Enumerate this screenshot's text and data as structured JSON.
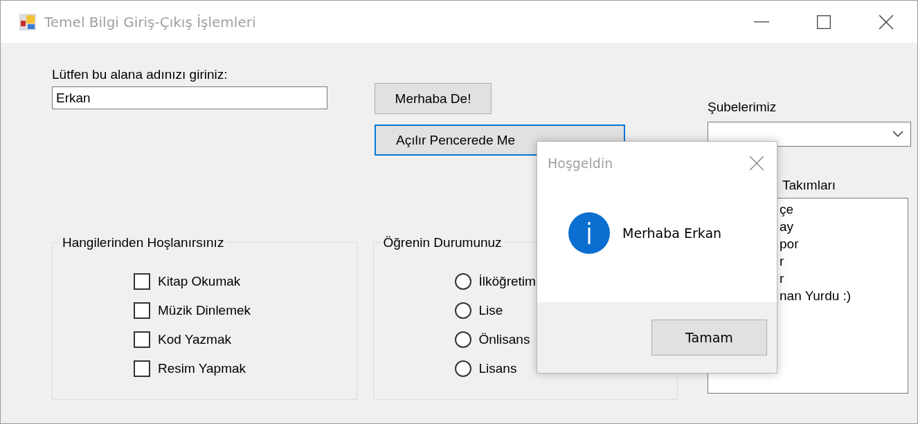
{
  "window": {
    "title": "Temel Bilgi Giriş-Çıkış İşlemleri"
  },
  "name_input": {
    "label": "Lütfen bu alana adınızı giriniz:",
    "value": "Erkan"
  },
  "buttons": [
    {
      "label": "Merhaba De!",
      "focused": false
    },
    {
      "label": "Açılır Pencerede Me",
      "focused": true
    }
  ],
  "hobbies": {
    "title": "Hangilerinden Hoşlanırsınız",
    "items": [
      {
        "label": "Kitap Okumak",
        "checked": false
      },
      {
        "label": "Müzik Dinlemek",
        "checked": false
      },
      {
        "label": "Kod Yazmak",
        "checked": false
      },
      {
        "label": "Resim Yapmak",
        "checked": false
      }
    ]
  },
  "education": {
    "title": "Öğrenin Durumunuz",
    "options": [
      {
        "label": "İlköğretim",
        "selected": false
      },
      {
        "label": "Lise",
        "selected": false
      },
      {
        "label": "Önlisans",
        "selected": false
      },
      {
        "label": "Lisans",
        "selected": false
      }
    ]
  },
  "branches": {
    "label": "Şubelerimiz"
  },
  "teams": {
    "label": "Takımları",
    "items": [
      {
        "text": "çe"
      },
      {
        "text": "ay"
      },
      {
        "text": "por"
      },
      {
        "text": "r"
      },
      {
        "text": "r"
      },
      {
        "text": "nan Yurdu :)"
      }
    ]
  },
  "dialog": {
    "title": "Hoşgeldin",
    "message": "Merhaba Erkan",
    "button": "Tamam"
  }
}
